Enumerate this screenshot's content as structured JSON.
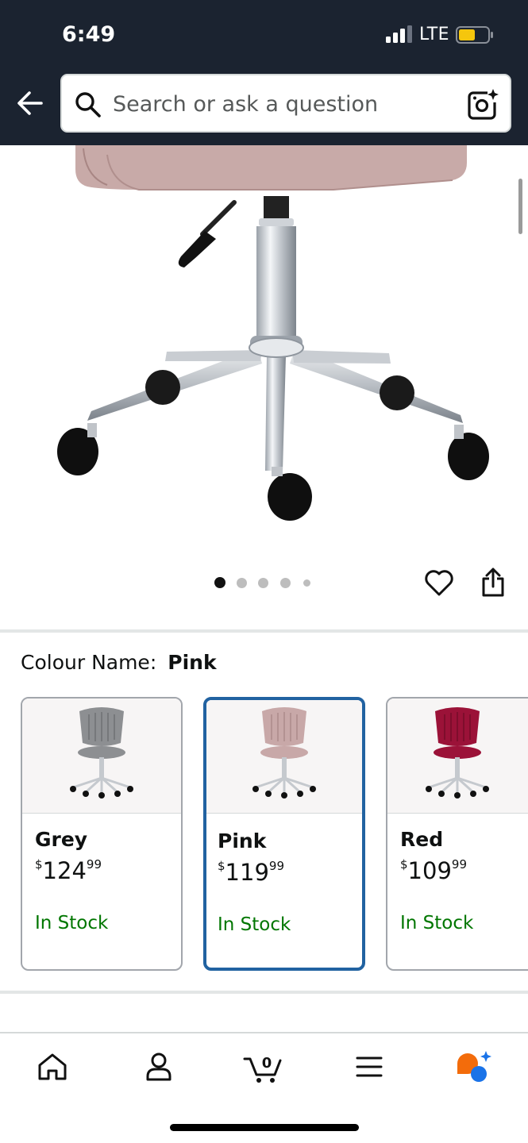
{
  "status_bar": {
    "time": "6:49",
    "network": "LTE",
    "battery_color": "#f5c60d"
  },
  "header": {
    "background": "#1b2330",
    "back_icon": "back-arrow-icon",
    "search": {
      "placeholder": "Search or ask a question",
      "search_icon": "search-icon",
      "camera_icon": "camera-search-icon"
    }
  },
  "gallery": {
    "image_count": 5,
    "active_index": 0,
    "wishlist_icon": "heart-icon",
    "share_icon": "share-icon"
  },
  "variation": {
    "label": "Colour Name:",
    "selected_value": "Pink",
    "options": [
      {
        "name": "Grey",
        "price_symbol": "$",
        "price_whole": "124",
        "price_fraction": "99",
        "availability": "In Stock",
        "color": "#8d8f92",
        "selected": false
      },
      {
        "name": "Pink",
        "price_symbol": "$",
        "price_whole": "119",
        "price_fraction": "99",
        "availability": "In Stock",
        "color": "#c8a8a8",
        "selected": true
      },
      {
        "name": "Red",
        "price_symbol": "$",
        "price_whole": "109",
        "price_fraction": "99",
        "availability": "In Stock",
        "color": "#9b1238",
        "selected": false
      }
    ]
  },
  "bottom_nav": {
    "items": [
      {
        "icon": "home-icon"
      },
      {
        "icon": "account-icon"
      },
      {
        "icon": "cart-icon",
        "count": "0"
      },
      {
        "icon": "menu-icon"
      },
      {
        "icon": "rufus-assistant-icon"
      }
    ]
  },
  "colors": {
    "accent_selected": "#2162a1",
    "in_stock": "#007600"
  }
}
